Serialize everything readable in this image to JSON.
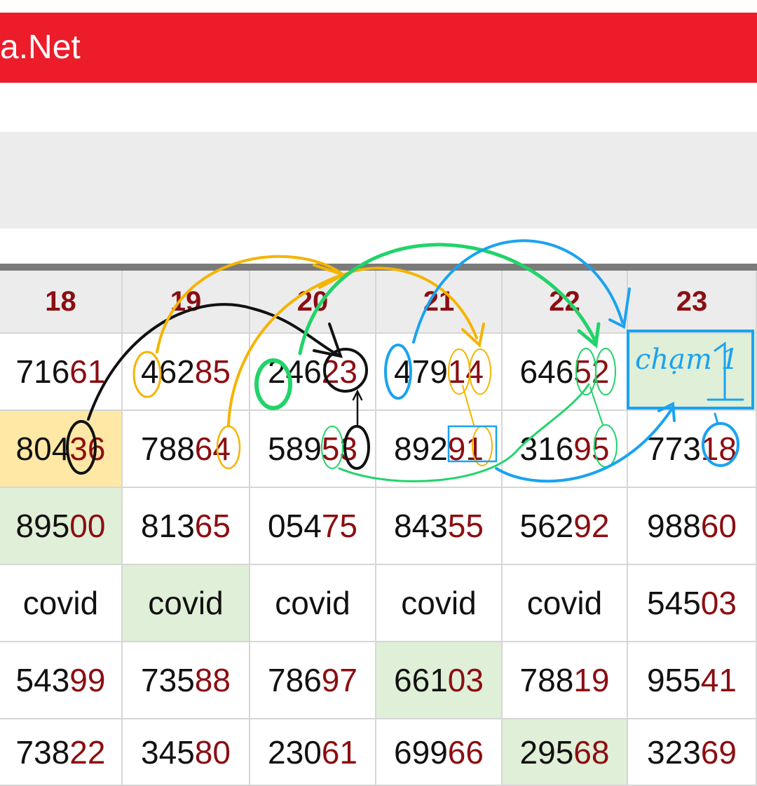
{
  "header": {
    "title": "a.Net"
  },
  "table": {
    "columns": [
      "18",
      "19",
      "20",
      "21",
      "22",
      "23"
    ],
    "rows": [
      [
        {
          "head": "716",
          "tail": "61"
        },
        {
          "head": "462",
          "tail": "85"
        },
        {
          "head": "246",
          "tail": "23"
        },
        {
          "head": "479",
          "tail": "14"
        },
        {
          "head": "646",
          "tail": "52"
        },
        {
          "note": "chạm 1"
        }
      ],
      [
        {
          "head": "804",
          "tail": "36",
          "hl": "yellow"
        },
        {
          "head": "788",
          "tail": "64"
        },
        {
          "head": "589",
          "tail": "53"
        },
        {
          "head": "892",
          "tail": "91"
        },
        {
          "head": "316",
          "tail": "95"
        },
        {
          "head": "773",
          "tail": "18"
        }
      ],
      [
        {
          "head": "895",
          "tail": "00",
          "hl": "green"
        },
        {
          "head": "813",
          "tail": "65"
        },
        {
          "head": "054",
          "tail": "75"
        },
        {
          "head": "843",
          "tail": "55"
        },
        {
          "head": "562",
          "tail": "92"
        },
        {
          "head": "988",
          "tail": "60"
        }
      ],
      [
        {
          "text": "covid"
        },
        {
          "text": "covid",
          "hl": "green"
        },
        {
          "text": "covid"
        },
        {
          "text": "covid"
        },
        {
          "text": "covid"
        },
        {
          "head": "545",
          "tail": "03"
        }
      ],
      [
        {
          "head": "543",
          "tail": "99"
        },
        {
          "head": "735",
          "tail": "88"
        },
        {
          "head": "786",
          "tail": "97"
        },
        {
          "head": "661",
          "tail": "03",
          "hl": "green"
        },
        {
          "head": "788",
          "tail": "19"
        },
        {
          "head": "955",
          "tail": "41"
        }
      ],
      [
        {
          "head": "738",
          "tail": "22"
        },
        {
          "head": "345",
          "tail": "80"
        },
        {
          "head": "230",
          "tail": "61"
        },
        {
          "head": "699",
          "tail": "66"
        },
        {
          "head": "295",
          "tail": "68",
          "hl": "green"
        },
        {
          "head": "323",
          "tail": "69"
        }
      ]
    ]
  },
  "annotation": {
    "note_text": "chạm 1"
  },
  "colors": {
    "brand_red": "#ec1c2a",
    "number_tail": "#8b0e12",
    "highlight_yellow": "#ffe8a6",
    "highlight_green": "#e0efd7",
    "pen_black": "#111111",
    "pen_orange": "#f5b400",
    "pen_green": "#22d36a",
    "pen_blue": "#1aa3f0"
  }
}
